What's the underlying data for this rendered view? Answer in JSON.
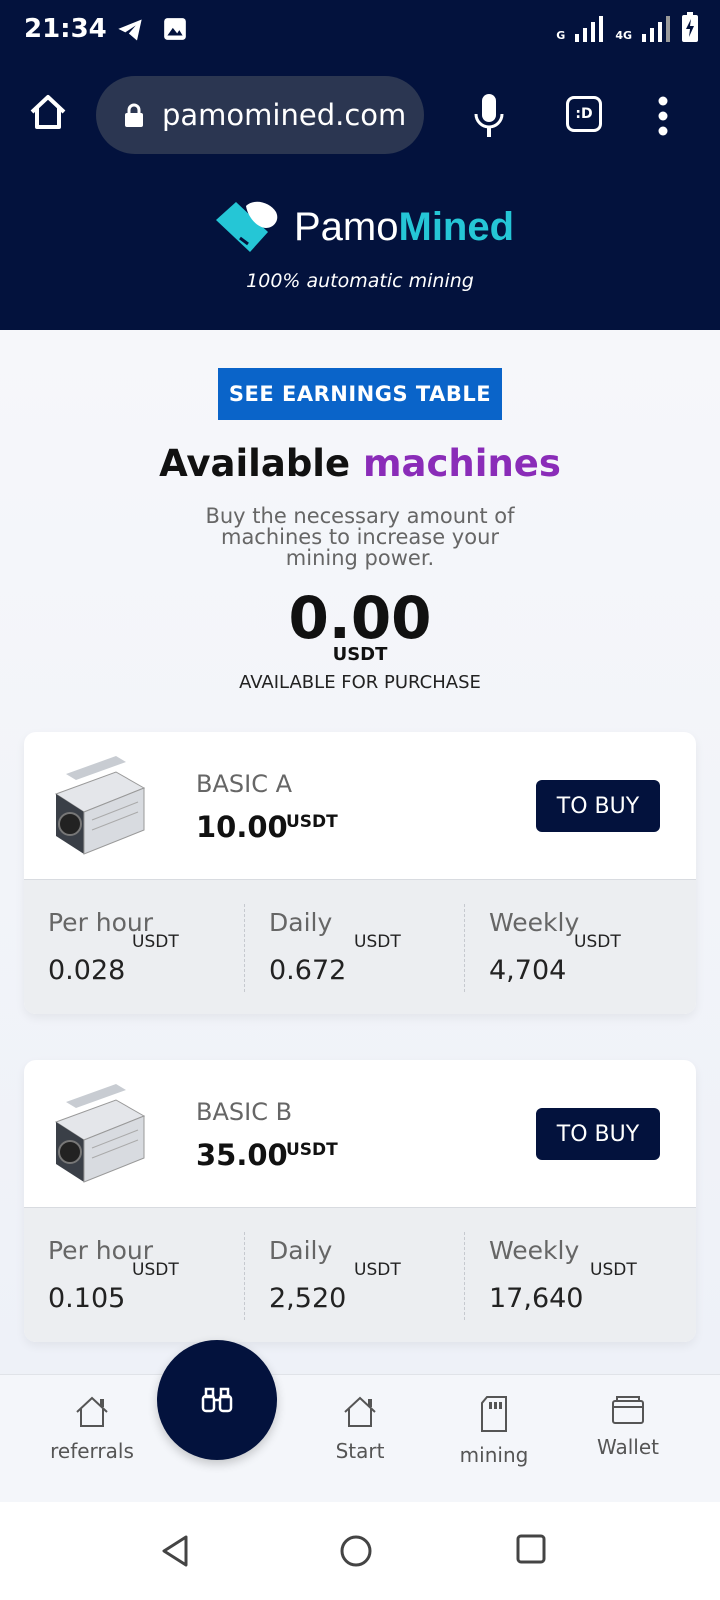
{
  "status_bar": {
    "time": "21:34",
    "signal1_label": "G",
    "signal2_label": "4G"
  },
  "browser": {
    "url": "pamomined.com",
    "tabs_label": ":D"
  },
  "brand": {
    "name_part1": "Pamo",
    "name_part2": "Mined",
    "tagline": "100% automatic mining"
  },
  "hero": {
    "earnings_button": "SEE EARNINGS TABLE",
    "title_plain": "Available ",
    "title_accent": "machines",
    "description": "Buy the necessary amount of machines to increase your mining power.",
    "balance": "0.00",
    "balance_unit": "USDT",
    "balance_label": "AVAILABLE FOR PURCHASE"
  },
  "machines": [
    {
      "name": "BASIC A",
      "price": "10.00",
      "unit": "USDT",
      "buy_label": "TO BUY",
      "stats": [
        {
          "label": "Per hour",
          "value": "0.028",
          "unit": "USDT"
        },
        {
          "label": "Daily",
          "value": "0.672",
          "unit": "USDT"
        },
        {
          "label": "Weekly",
          "value": "4,704",
          "unit": "USDT"
        }
      ]
    },
    {
      "name": "BASIC B",
      "price": "35.00",
      "unit": "USDT",
      "buy_label": "TO BUY",
      "stats": [
        {
          "label": "Per hour",
          "value": "0.105",
          "unit": "USDT"
        },
        {
          "label": "Daily",
          "value": "2,520",
          "unit": "USDT"
        },
        {
          "label": "Weekly",
          "value": "17,640",
          "unit": "USDT"
        }
      ]
    }
  ],
  "bottom_nav": [
    {
      "label": "referrals",
      "icon": "home-icon"
    },
    {
      "label": "",
      "icon": "binoculars-icon"
    },
    {
      "label": "Start",
      "icon": "home-icon"
    },
    {
      "label": "mining",
      "icon": "sd-card-icon"
    },
    {
      "label": "Wallet",
      "icon": "wallet-icon"
    }
  ],
  "colors": {
    "navy": "#03123d",
    "brand_cyan": "#25c6d6",
    "accent_purple": "#8a2cb8",
    "button_blue": "#0a64c9"
  }
}
